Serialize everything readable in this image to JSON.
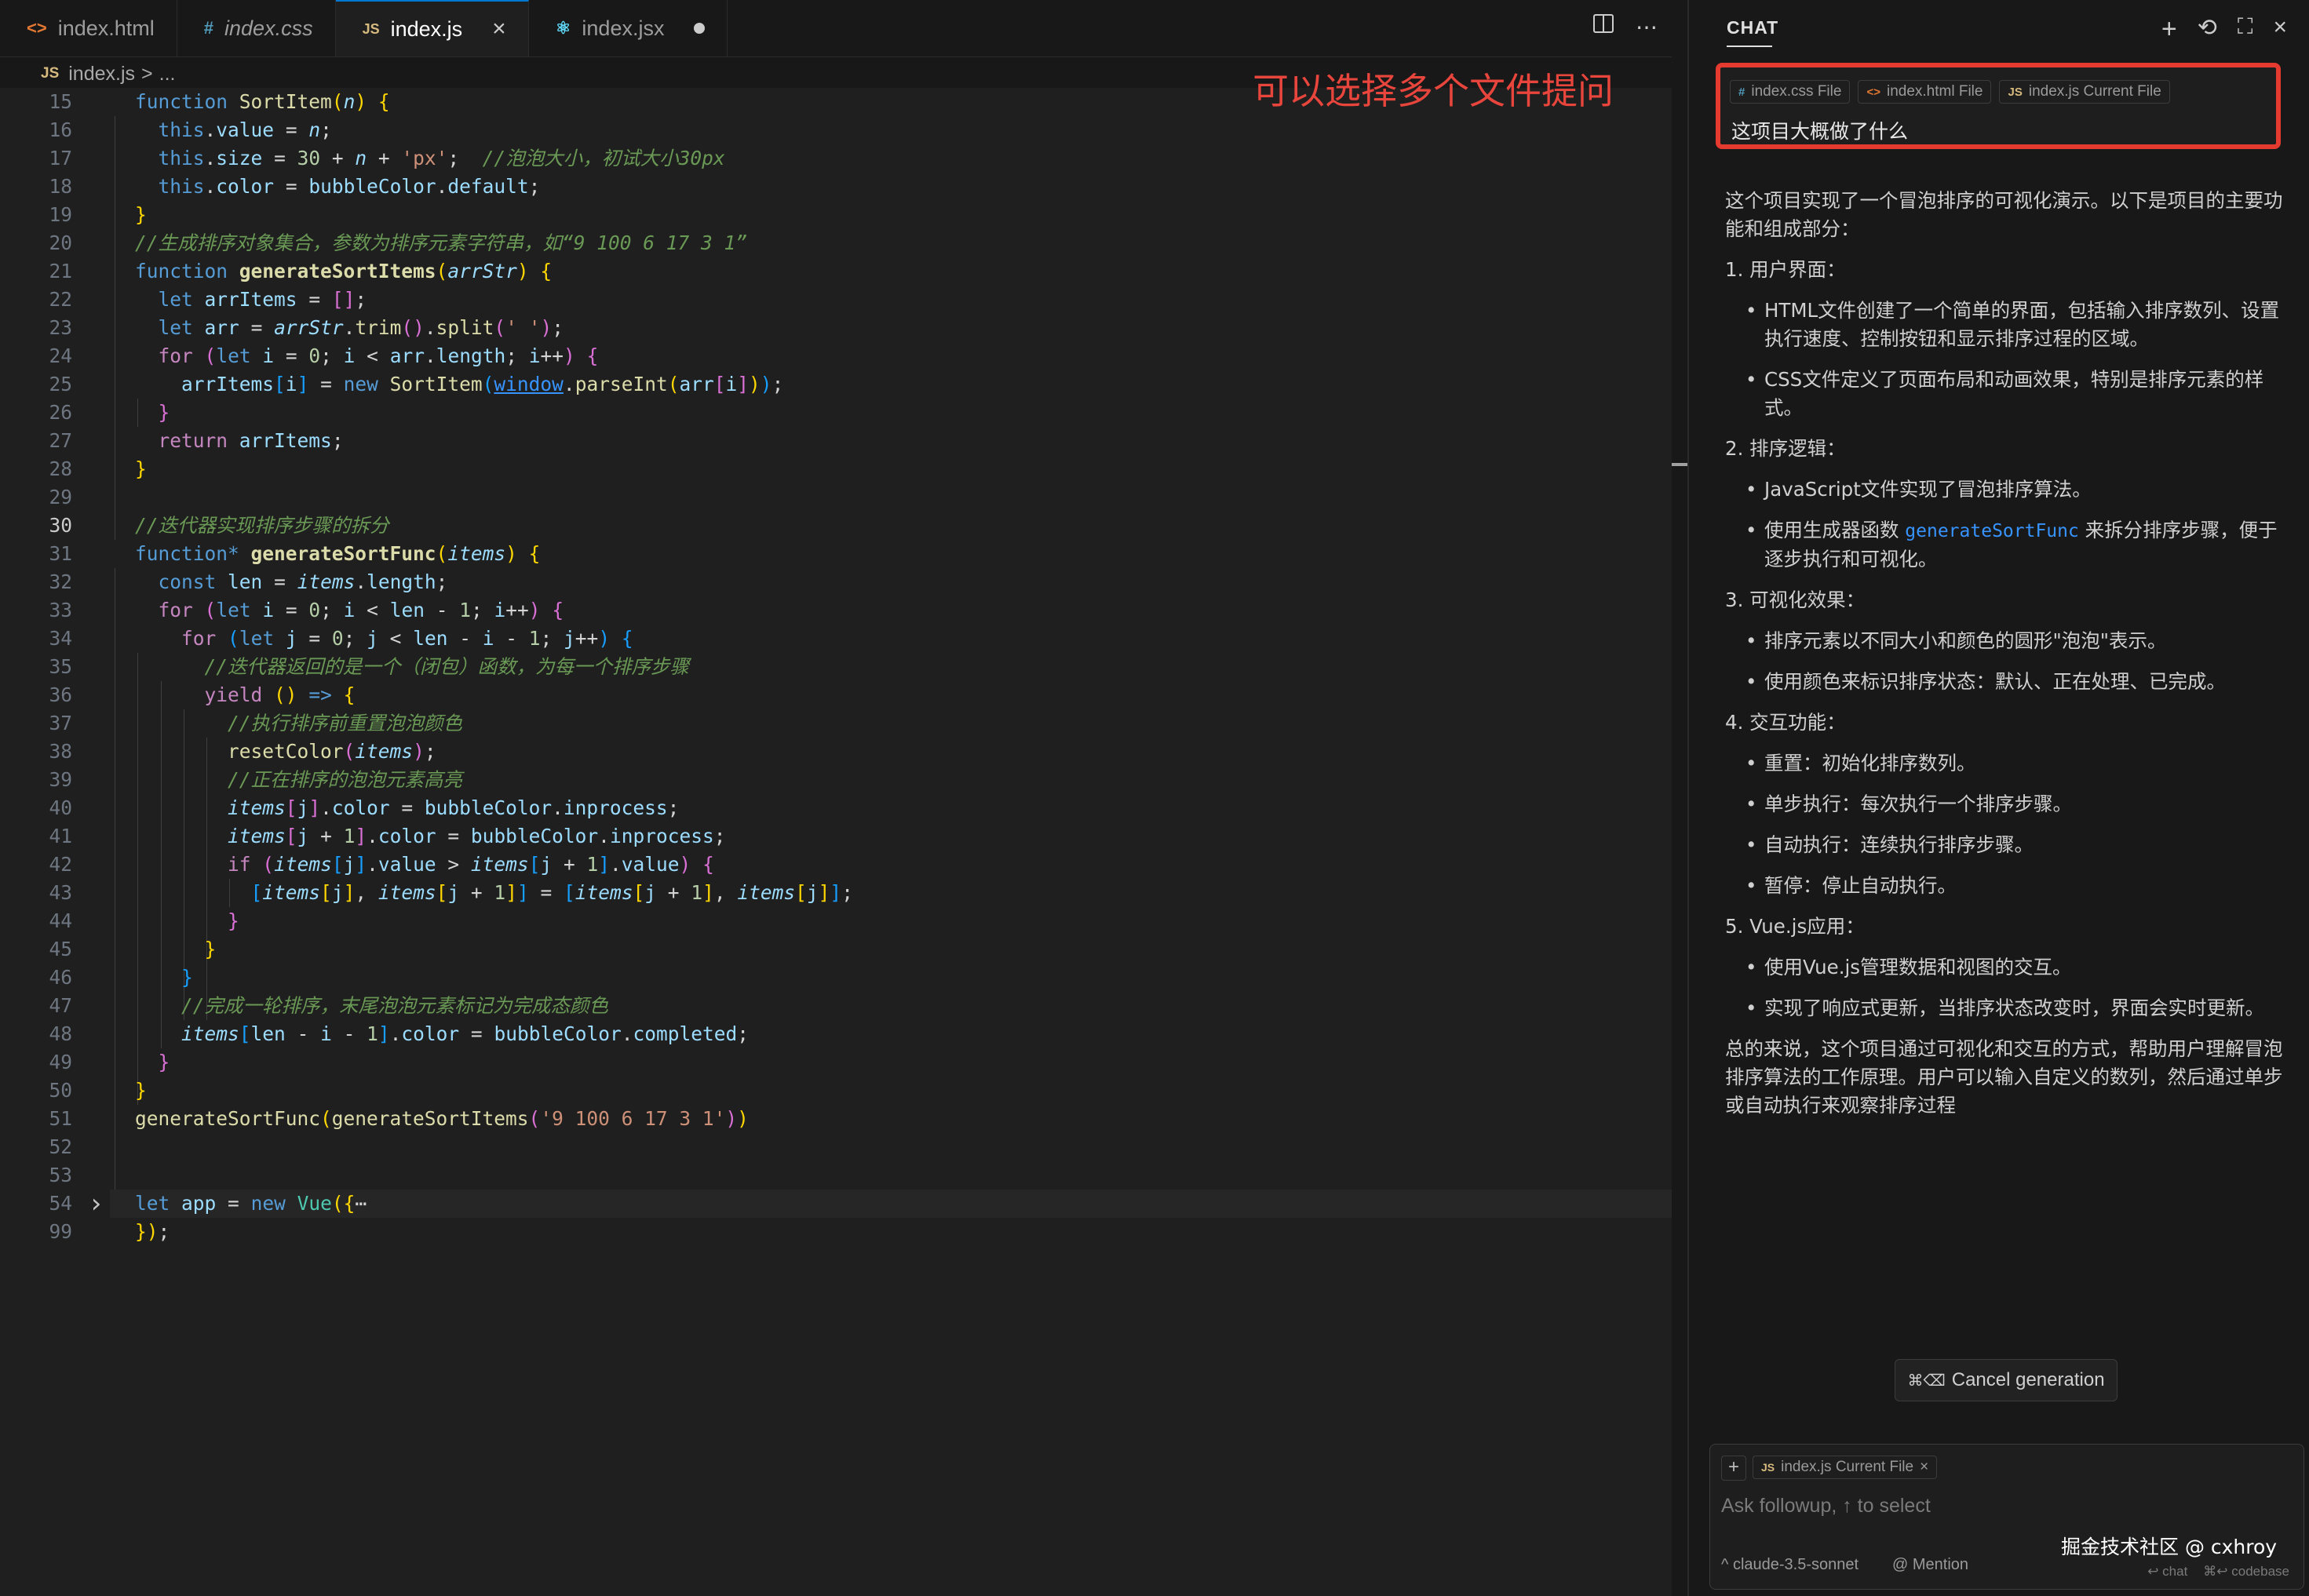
{
  "tabs": [
    {
      "icon": "<>",
      "label": "index.html"
    },
    {
      "icon": "#",
      "label": "index.css"
    },
    {
      "icon": "JS",
      "label": "index.js"
    },
    {
      "icon": "⚛",
      "label": "index.jsx"
    }
  ],
  "breadcrumb": {
    "icon": "JS",
    "file": "index.js",
    "sep": ">",
    "more": "..."
  },
  "annotation": "可以选择多个文件提问",
  "editor": {
    "line_numbers": [
      "15",
      "16",
      "17",
      "18",
      "19",
      "20",
      "21",
      "22",
      "23",
      "24",
      "25",
      "26",
      "27",
      "28",
      "29",
      "30",
      "31",
      "32",
      "33",
      "34",
      "35",
      "36",
      "37",
      "38",
      "39",
      "40",
      "41",
      "42",
      "43",
      "44",
      "45",
      "46",
      "47",
      "48",
      "49",
      "50",
      "51",
      "52",
      "53",
      "54",
      "99"
    ],
    "current_line": "30"
  },
  "chat": {
    "title": "CHAT",
    "chips": [
      {
        "icon": "#",
        "label": "index.css File"
      },
      {
        "icon": "<>",
        "label": "index.html File"
      },
      {
        "icon": "JS",
        "label": "index.js Current File"
      }
    ],
    "question": "这项目大概做了什么",
    "intro": "这个项目实现了一个冒泡排序的可视化演示。以下是项目的主要功能和组成部分：",
    "sections": [
      {
        "heading": "1. 用户界面：",
        "bullets": [
          "HTML文件创建了一个简单的界面，包括输入排序数列、设置执行速度、控制按钮和显示排序过程的区域。",
          "CSS文件定义了页面布局和动画效果，特别是排序元素的样式。"
        ]
      },
      {
        "heading": "2. 排序逻辑：",
        "bullets": [
          "JavaScript文件实现了冒泡排序算法。"
        ]
      },
      {
        "heading": "3. 可视化效果：",
        "bullets": [
          "排序元素以不同大小和颜色的圆形\"泡泡\"表示。",
          "使用颜色来标识排序状态：默认、正在处理、已完成。"
        ]
      },
      {
        "heading": "4. 交互功能：",
        "bullets": [
          "重置：初始化排序数列。",
          "单步执行：每次执行一个排序步骤。",
          "自动执行：连续执行排序步骤。",
          "暂停：停止自动执行。"
        ]
      },
      {
        "heading": "5. Vue.js应用：",
        "bullets": [
          "使用Vue.js管理数据和视图的交互。",
          "实现了响应式更新，当排序状态改变时，界面会实时更新。"
        ]
      }
    ],
    "generator_bullet": {
      "before": "使用生成器函数 ",
      "code": "generateSortFunc",
      "after": " 来拆分排序步骤，便于逐步执行和可视化。"
    },
    "conclusion": "总的来说，这个项目通过可视化和交互的方式，帮助用户理解冒泡排序算法的工作原理。用户可以输入自定义的数列，然后通过单步或自动执行来观察排序过程",
    "cancel_label": "Cancel generation",
    "cancel_shortcut": "⌘⌫",
    "input_chip": "index.js Current File",
    "input_placeholder": "Ask followup, ↑ to select",
    "model": "claude-3.5-sonnet",
    "mention": "@ Mention",
    "hint_chat": "↩ chat",
    "hint_codebase": "⌘↩ codebase",
    "watermark": "掘金技术社区 @ cxhroy"
  },
  "colors": {
    "accent": "#0078d4",
    "annotation": "#e8453c",
    "highlight_border": "#e53a2f"
  }
}
